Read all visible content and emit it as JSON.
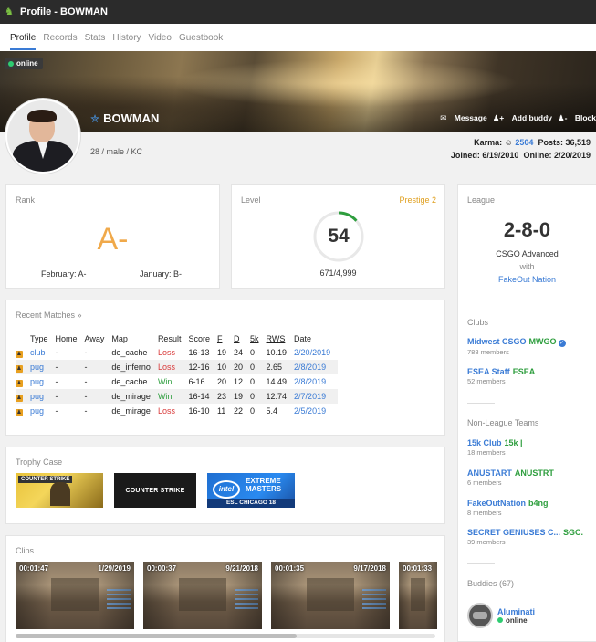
{
  "window": {
    "title": "Profile - BOWMAN"
  },
  "tabs": [
    {
      "label": "Profile",
      "active": true
    },
    {
      "label": "Records"
    },
    {
      "label": "Stats"
    },
    {
      "label": "History"
    },
    {
      "label": "Video"
    },
    {
      "label": "Guestbook"
    }
  ],
  "profile": {
    "status": "online",
    "name": "BOWMAN",
    "info": "28 / male / KC",
    "actions": {
      "message": "Message",
      "add_buddy": "Add buddy",
      "block": "Block"
    },
    "karma_label": "Karma:",
    "karma": "2504",
    "posts_label": "Posts:",
    "posts": "36,519",
    "joined_label": "Joined:",
    "joined": "6/19/2010",
    "online_label": "Online:",
    "online": "2/20/2019"
  },
  "rank": {
    "title": "Rank",
    "value": "A-",
    "prev1": "February: A-",
    "prev2": "January: B-"
  },
  "level": {
    "title": "Level",
    "prestige": "Prestige 2",
    "value": "54",
    "xp": "671/4,999",
    "progress": 0.134
  },
  "league": {
    "title": "League",
    "record": "2-8-0",
    "name": "CSGO Advanced",
    "with": "with",
    "team": "FakeOut Nation"
  },
  "clubs": {
    "title": "Clubs",
    "items": [
      {
        "name": "Midwest CSGO",
        "tag": "MWGO",
        "members": "788 members",
        "verified": true
      },
      {
        "name": "ESEA Staff",
        "tag": "ESEA",
        "members": "52 members"
      }
    ]
  },
  "teams": {
    "title": "Non-League Teams",
    "items": [
      {
        "name": "15k Club",
        "tag": "15k |",
        "members": "18 members"
      },
      {
        "name": "ANUSTART",
        "tag": "ANUSTRT",
        "members": "6 members"
      },
      {
        "name": "FakeOutNation",
        "tag": "b4ng",
        "members": "8 members"
      },
      {
        "name": "SECRET GENIUSES C...",
        "tag": "SGC.",
        "members": "39 members"
      }
    ]
  },
  "buddies": {
    "title": "Buddies (67)",
    "first": {
      "name": "Aluminati",
      "status": "online"
    }
  },
  "matches": {
    "title": "Recent Matches »",
    "headers": [
      "Type",
      "Home",
      "Away",
      "Map",
      "Result",
      "Score",
      "F",
      "D",
      "5k",
      "RWS",
      "Date"
    ],
    "rows": [
      {
        "type": "club",
        "home": "-",
        "away": "-",
        "map": "de_cache",
        "result": "Loss",
        "score": "16-13",
        "f": "19",
        "d": "24",
        "k5": "0",
        "rws": "10.19",
        "date": "2/20/2019"
      },
      {
        "type": "pug",
        "home": "-",
        "away": "-",
        "map": "de_inferno",
        "result": "Loss",
        "score": "12-16",
        "f": "10",
        "d": "20",
        "k5": "0",
        "rws": "2.65",
        "date": "2/8/2019"
      },
      {
        "type": "pug",
        "home": "-",
        "away": "-",
        "map": "de_cache",
        "result": "Win",
        "score": "6-16",
        "f": "20",
        "d": "12",
        "k5": "0",
        "rws": "14.49",
        "date": "2/8/2019"
      },
      {
        "type": "pug",
        "home": "-",
        "away": "-",
        "map": "de_mirage",
        "result": "Win",
        "score": "16-14",
        "f": "23",
        "d": "19",
        "k5": "0",
        "rws": "12.74",
        "date": "2/7/2019"
      },
      {
        "type": "pug",
        "home": "-",
        "away": "-",
        "map": "de_mirage",
        "result": "Loss",
        "score": "16-10",
        "f": "11",
        "d": "22",
        "k5": "0",
        "rws": "5.4",
        "date": "2/5/2019"
      }
    ]
  },
  "trophies": {
    "title": "Trophy Case",
    "items": [
      {
        "label": "COUNTER STRIKE"
      },
      {
        "label": "COUNTER STRIKE"
      },
      {
        "brand": "intel",
        "title": "EXTREME MASTERS",
        "sub": "ESL CHICAGO 18"
      }
    ]
  },
  "clips": {
    "title": "Clips",
    "items": [
      {
        "time": "00:01:47",
        "date": "1/29/2019"
      },
      {
        "time": "00:00:37",
        "date": "9/21/2018"
      },
      {
        "time": "00:01:35",
        "date": "9/17/2018"
      },
      {
        "time": "00:01:33",
        "date": ""
      }
    ]
  },
  "colors": {
    "accent": "#3a7bd5",
    "win": "#2e9e3e",
    "loss": "#d93a3a",
    "rank": "#f0a94a",
    "prestige": "#e0a020"
  }
}
